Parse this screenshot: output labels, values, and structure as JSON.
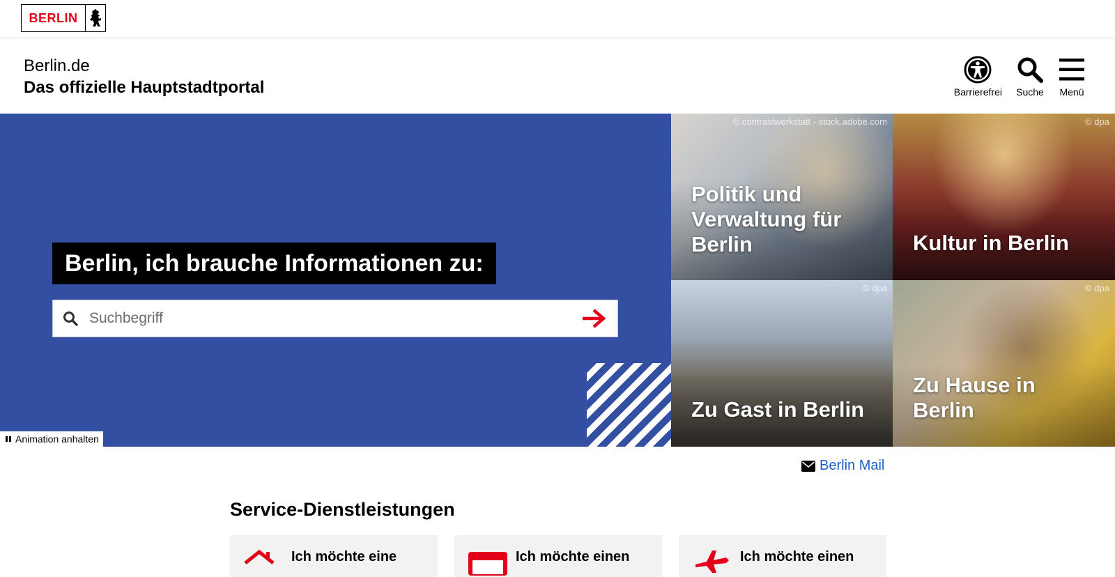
{
  "logo": {
    "text": "BERLIN"
  },
  "header": {
    "site_title": "Berlin.de",
    "site_subtitle": "Das offizielle Hauptstadtportal",
    "tools": [
      {
        "label": "Barrierefrei",
        "icon": "accessibility-icon"
      },
      {
        "label": "Suche",
        "icon": "search-icon"
      },
      {
        "label": "Menü",
        "icon": "menu-icon"
      }
    ]
  },
  "hero": {
    "heading": "Berlin, ich brauche Informationen zu:",
    "search_placeholder": "Suchbegriff",
    "animation_button": "Animation anhalten",
    "background_color": "#334fa2",
    "tiles": [
      {
        "title": "Politik und Verwaltung für Berlin",
        "credit": "© contrastwerkstatt - stock.adobe.com"
      },
      {
        "title": "Kultur in Berlin",
        "credit": "© dpa"
      },
      {
        "title": "Zu Gast in Berlin",
        "credit": "© dpa"
      },
      {
        "title": "Zu Hause in Berlin",
        "credit": "© dpa"
      }
    ]
  },
  "mail_link": {
    "label": "Berlin Mail"
  },
  "services": {
    "title": "Service-Dienstleistungen",
    "cards": [
      {
        "label": "Ich möchte eine",
        "icon": "house-icon"
      },
      {
        "label": "Ich möchte einen",
        "icon": "calendar-icon"
      },
      {
        "label": "Ich möchte einen",
        "icon": "plane-icon"
      }
    ]
  },
  "colors": {
    "accent_red": "#e2001a",
    "link_blue": "#1f5fc6"
  }
}
